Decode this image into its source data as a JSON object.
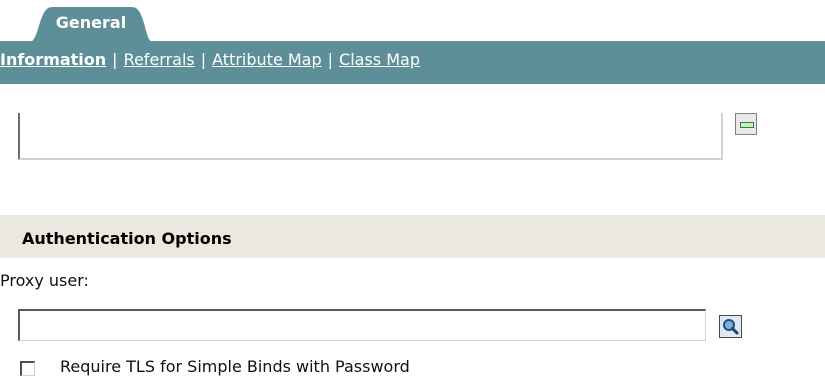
{
  "tab": {
    "label": "General"
  },
  "subnav": {
    "items": [
      {
        "label": "Information"
      },
      {
        "label": "Referrals"
      },
      {
        "label": "Attribute Map"
      },
      {
        "label": "Class Map"
      }
    ],
    "separator": "|"
  },
  "authentication": {
    "section_title": "Authentication Options",
    "proxy_user_label": "Proxy user:",
    "proxy_user_value": "",
    "tls_checkbox_label": "Require TLS for Simple Binds with Password",
    "tls_checked": false
  },
  "colors": {
    "tab_bg": "#5e8f99",
    "subnav_bg": "#5e8f99",
    "section_header_bg": "#ebe8e0"
  },
  "icons": {
    "edit": "edit-list-icon",
    "search": "magnifier-icon"
  }
}
